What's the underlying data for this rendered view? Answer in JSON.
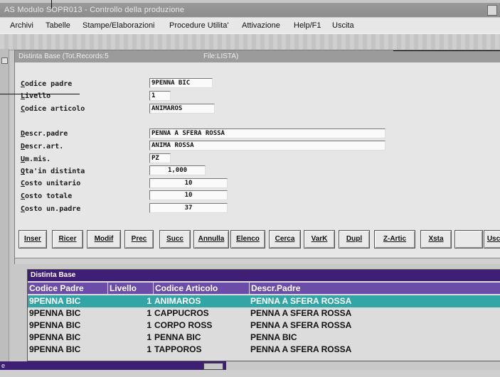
{
  "app": {
    "title": "AS Modulo SOPR013 - Controllo della produzione",
    "menu": [
      "Archivi",
      "Tabelle",
      "Stampe/Elaborazioni",
      "Procedure Utilita'",
      "Attivazione",
      "Help/F1",
      "Uscita"
    ]
  },
  "child": {
    "title_left": "Distinta Base (Tot.Records:5",
    "title_right": "File:LISTA)",
    "fields": {
      "codice_padre": {
        "label": "Codice padre",
        "value": "9PENNA BIC"
      },
      "livello": {
        "label": "Livello",
        "value": "1"
      },
      "codice_articolo": {
        "label": "Codice articolo",
        "value": "ANIMAROS"
      },
      "descr_padre": {
        "label": "Descr.padre",
        "value": "PENNA A SFERA ROSSA"
      },
      "descr_art": {
        "label": "Descr.art.",
        "value": "ANIMA ROSSA"
      },
      "um_mis": {
        "label": "Um.mis.",
        "value": "PZ"
      },
      "qta_distinta": {
        "label": "Qta'in distinta",
        "value": "1,000"
      },
      "costo_unitario": {
        "label": "Costo unitario",
        "value": "10"
      },
      "costo_totale": {
        "label": "Costo totale",
        "value": "10"
      },
      "costo_un_padre": {
        "label": "Costo un.padre",
        "value": "37"
      }
    },
    "buttons": [
      "Inser",
      "Ricer",
      "Modif",
      "Prec",
      "Succ",
      "Annulla",
      "Elenco",
      "Cerca",
      "VarK",
      "Dupl",
      "Z-Artic",
      "Xsta",
      "",
      "Usc"
    ]
  },
  "grid": {
    "title": "Distinta Base",
    "columns": [
      "Codice Padre",
      "Livello",
      "Codice Articolo",
      "Descr.Padre"
    ],
    "rows": [
      {
        "codice_padre": "9PENNA BIC",
        "livello": "1",
        "codice_articolo": "ANIMAROS",
        "descr_padre": "PENNA A SFERA ROSSA",
        "selected": true
      },
      {
        "codice_padre": "9PENNA BIC",
        "livello": "1",
        "codice_articolo": "CAPPUCROS",
        "descr_padre": "PENNA A SFERA ROSSA",
        "selected": false
      },
      {
        "codice_padre": "9PENNA BIC",
        "livello": "1",
        "codice_articolo": "CORPO ROSS",
        "descr_padre": "PENNA A SFERA ROSSA",
        "selected": false
      },
      {
        "codice_padre": "9PENNA BIC",
        "livello": "1",
        "codice_articolo": "PENNA BIC",
        "descr_padre": "PENNA BIC",
        "selected": false
      },
      {
        "codice_padre": "9PENNA BIC",
        "livello": "1",
        "codice_articolo": "TAPPOROS",
        "descr_padre": "PENNA A SFERA ROSSA",
        "selected": false
      }
    ]
  },
  "minimized": {
    "label": "e"
  },
  "colors": {
    "grid_title": "#3f1f76",
    "grid_header": "#6b4ca8",
    "selected_row": "#32a6a6"
  }
}
